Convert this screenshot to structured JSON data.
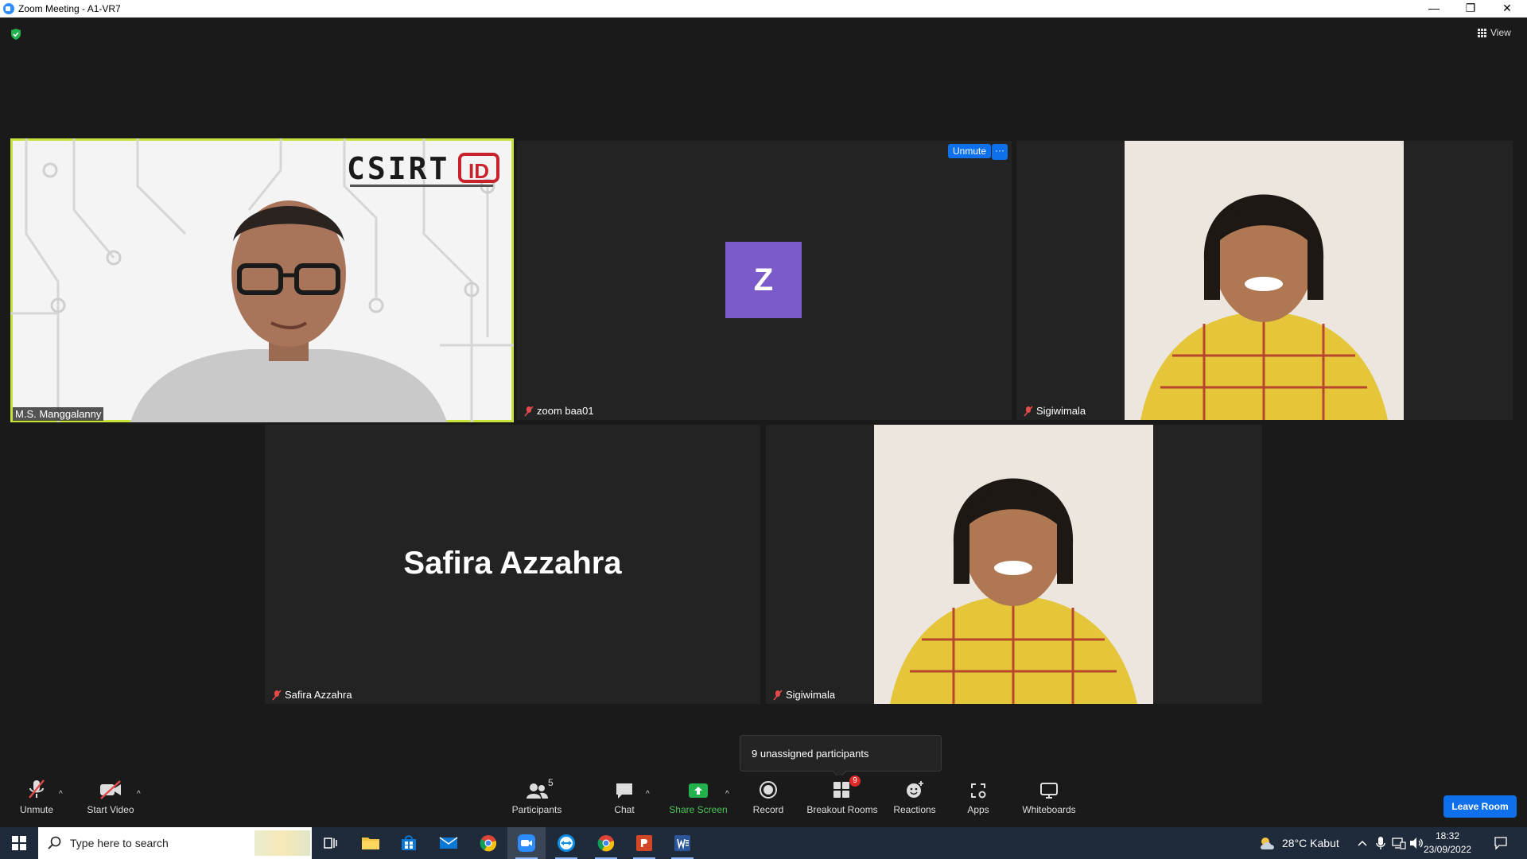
{
  "window": {
    "title": "Zoom Meeting - A1-VR7",
    "minimize": "—",
    "restore": "❐",
    "close": "✕"
  },
  "meeting": {
    "view_label": "View",
    "tiles": [
      {
        "name": "M.S. Manggalanny",
        "logo_text": "CSIRT",
        "logo_badge": "ID"
      },
      {
        "name": "zoom baa01",
        "avatar_letter": "Z",
        "unmute_label": "Unmute",
        "more_label": "···"
      },
      {
        "name": "Sigiwimala"
      },
      {
        "name": "Safira Azzahra",
        "display_name": "Safira Azzahra"
      },
      {
        "name": "Sigiwimala"
      }
    ],
    "tooltip": "9 unassigned participants"
  },
  "toolbar": {
    "unmute": "Unmute",
    "start_video": "Start Video",
    "participants": "Participants",
    "participants_count": "5",
    "chat": "Chat",
    "share_screen": "Share Screen",
    "record": "Record",
    "breakout_rooms": "Breakout Rooms",
    "breakout_badge": "9",
    "reactions": "Reactions",
    "apps": "Apps",
    "whiteboards": "Whiteboards",
    "leave_room": "Leave Room",
    "caret": "^"
  },
  "taskbar": {
    "search_placeholder": "Type here to search",
    "weather": "28°C  Kabut",
    "time": "18:32",
    "date": "23/09/2022"
  },
  "colors": {
    "accent_blue": "#0e71eb",
    "active_speaker": "#c9e23b",
    "avatar_purple": "#7b5bc9",
    "share_green": "#22b14c",
    "badge_red": "#e02828"
  }
}
